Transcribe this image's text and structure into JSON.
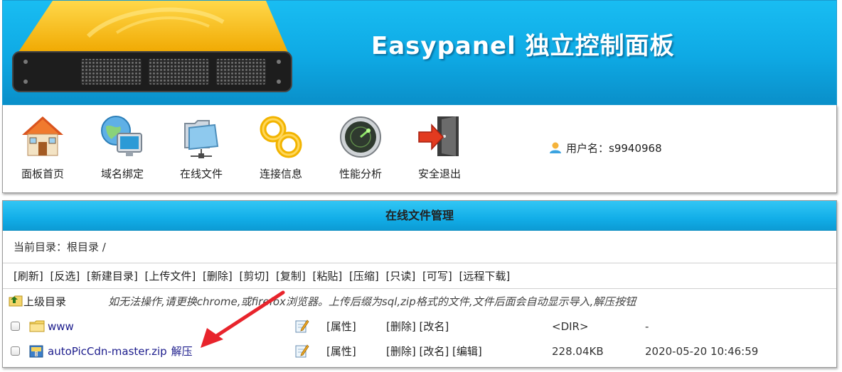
{
  "header": {
    "title": "Easypanel 独立控制面板",
    "colors": {
      "banner": "#0ea9e4",
      "logo_gold": "#f5b800"
    }
  },
  "toolbar": {
    "items": [
      {
        "label": "面板首页",
        "icon": "house-icon"
      },
      {
        "label": "域名绑定",
        "icon": "globe-monitor-icon"
      },
      {
        "label": "在线文件",
        "icon": "network-folder-icon"
      },
      {
        "label": "连接信息",
        "icon": "chain-link-icon"
      },
      {
        "label": "性能分析",
        "icon": "radar-gauge-icon"
      },
      {
        "label": "安全退出",
        "icon": "exit-door-icon"
      }
    ],
    "user": {
      "label": "用户名：",
      "value": "s9940968"
    }
  },
  "file_manager": {
    "title": "在线文件管理",
    "path_label": "当前目录：",
    "path_value": "根目录 /",
    "actions": [
      "[刷新]",
      "[反选]",
      "[新建目录]",
      "[上传文件]",
      "[删除]",
      "[剪切]",
      "[复制]",
      "[粘贴]",
      "[压缩]",
      "[只读]",
      "[可写]",
      "[远程下载]"
    ],
    "parent_label": "上级目录",
    "notice": "如无法操作,请更换chrome,或firefox浏览器。上传后缀为sql,zip格式的文件,文件后面会自动显示导入,解压按钮",
    "rows": [
      {
        "name": "www",
        "type": "folder",
        "attr": "[属性]",
        "delete": "[删除]",
        "rename": "[改名]",
        "edit": "",
        "size": "<DIR>",
        "time": "-"
      },
      {
        "name": "autoPicCdn-master.zip",
        "type": "zip",
        "extra": "解压",
        "attr": "[属性]",
        "delete": "[删除]",
        "rename": "[改名]",
        "edit": "[编辑]",
        "size": "228.04KB",
        "time": "2020-05-20 10:46:59"
      }
    ]
  },
  "annotation": {
    "arrow_color": "#e8242c"
  }
}
